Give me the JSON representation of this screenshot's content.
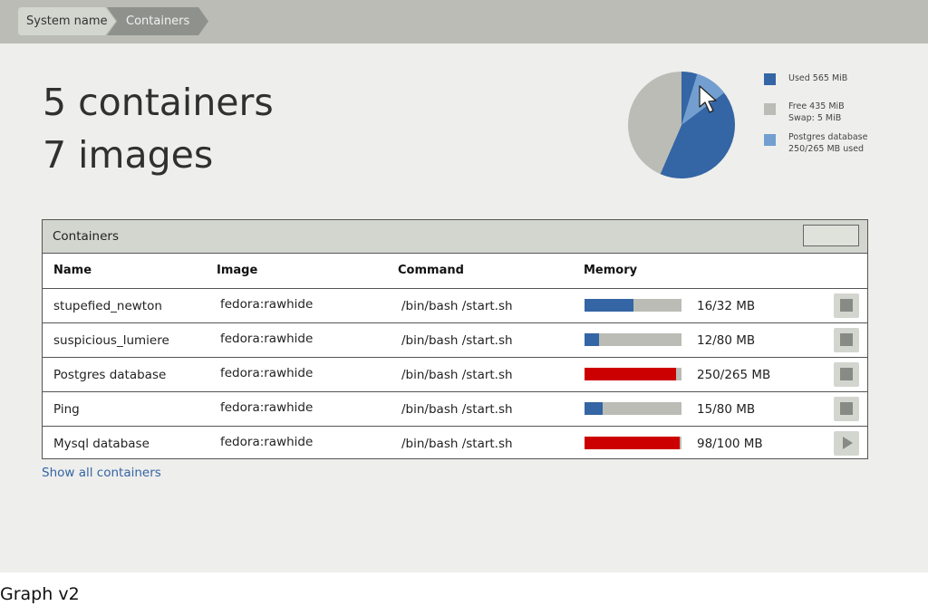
{
  "breadcrumb": {
    "items": [
      "System name",
      "Containers"
    ]
  },
  "summary": {
    "containers": "5 containers",
    "images": "7 images"
  },
  "chart_data": {
    "type": "pie",
    "slices": [
      {
        "label": "Used 565 MiB",
        "value": 565,
        "color": "#3465a4"
      },
      {
        "label": "Free 435 MiB",
        "value": 435,
        "color": "#babcb5"
      }
    ],
    "highlight": {
      "label": "Postgres database",
      "used": 250,
      "total": 265,
      "color": "#729fcf"
    },
    "legend": [
      {
        "lines": [
          "Used 565 MiB"
        ],
        "color": "#3465a4"
      },
      {
        "lines": [
          "Free 435 MiB",
          "Swap: 5 MiB"
        ],
        "color": "#babcb5"
      },
      {
        "lines": [
          "Postgres database",
          "250/265 MB used"
        ],
        "color": "#729fcf"
      }
    ]
  },
  "panel": {
    "title": "Containers",
    "columns": [
      "Name",
      "Image",
      "Command",
      "Memory"
    ],
    "rows": [
      {
        "name": "stupefied_newton",
        "image": "fedora:rawhide",
        "command": "/bin/bash /start.sh",
        "memory": "16/32 MB",
        "used": 16,
        "total": 32,
        "status": "normal",
        "action": "stop"
      },
      {
        "name": "suspicious_lumiere",
        "image": "fedora:rawhide",
        "command": "/bin/bash /start.sh",
        "memory": "12/80 MB",
        "used": 12,
        "total": 80,
        "status": "normal",
        "action": "stop"
      },
      {
        "name": "Postgres database",
        "image": "fedora:rawhide",
        "command": "/bin/bash /start.sh",
        "memory": "250/265 MB",
        "used": 250,
        "total": 265,
        "status": "critical",
        "action": "stop"
      },
      {
        "name": "Ping",
        "image": "fedora:rawhide",
        "command": "/bin/bash /start.sh",
        "memory": "15/80 MB",
        "used": 15,
        "total": 80,
        "status": "normal",
        "action": "stop"
      },
      {
        "name": "Mysql database",
        "image": "fedora:rawhide",
        "command": "/bin/bash /start.sh",
        "memory": "98/100 MB",
        "used": 98,
        "total": 100,
        "status": "critical",
        "action": "start"
      }
    ]
  },
  "links": {
    "show_all": "Show all containers"
  },
  "caption": "Graph v2",
  "colors": {
    "normal": "#3465a4",
    "critical": "#cc0000",
    "bar_bg": "#babcb5"
  }
}
